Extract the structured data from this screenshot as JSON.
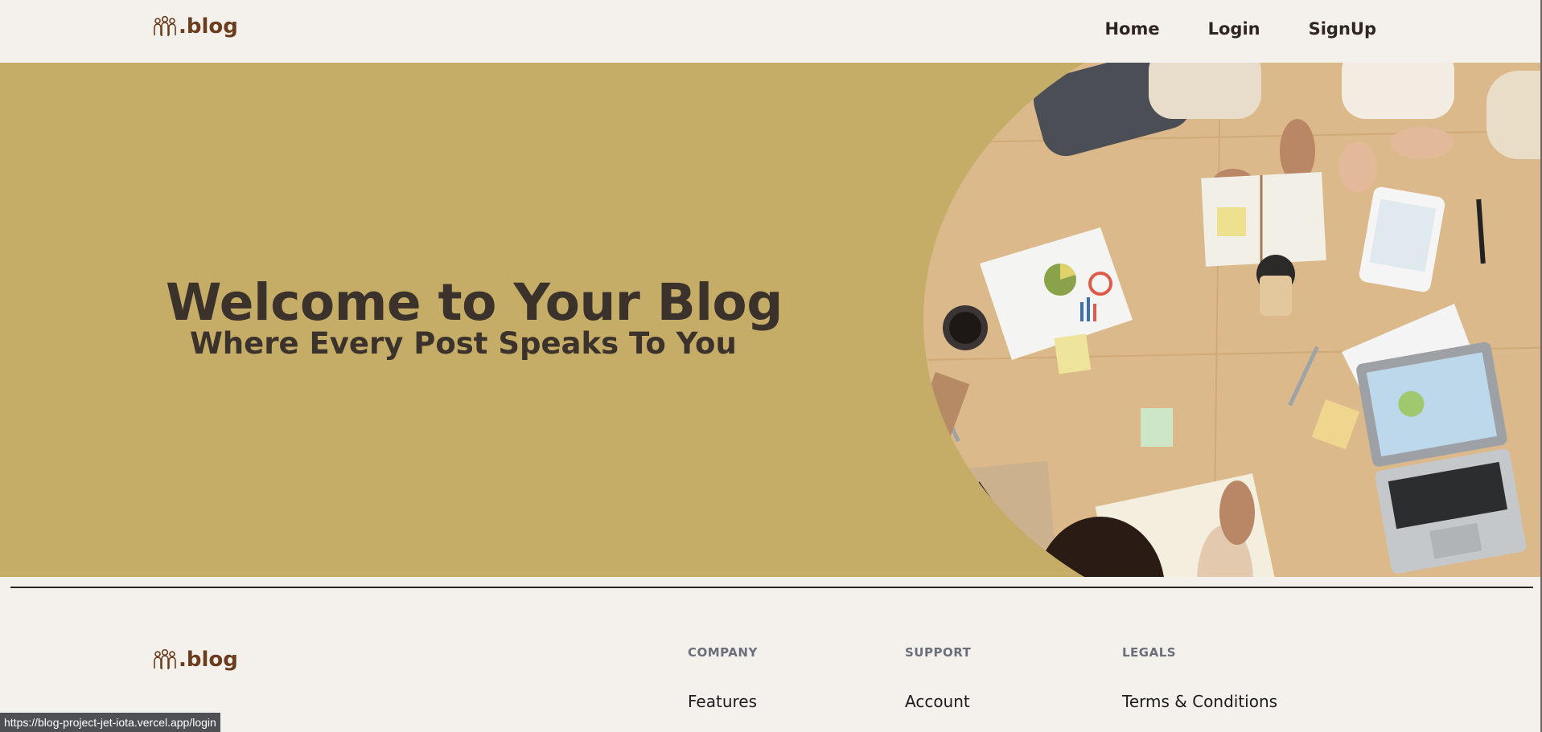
{
  "header": {
    "logo_text": ".blog",
    "nav": [
      {
        "label": "Home"
      },
      {
        "label": "Login"
      },
      {
        "label": "SignUp"
      }
    ]
  },
  "hero": {
    "title": "Welcome to Your Blog",
    "subtitle": "Where Every Post Speaks To You"
  },
  "footer": {
    "logo_text": ".blog",
    "columns": [
      {
        "heading": "COMPANY",
        "links": [
          "Features"
        ]
      },
      {
        "heading": "SUPPORT",
        "links": [
          "Account"
        ]
      },
      {
        "heading": "LEGALS",
        "links": [
          "Terms & Conditions"
        ]
      }
    ]
  },
  "status_bar": {
    "url": "https://blog-project-jet-iota.vercel.app/login"
  },
  "colors": {
    "background": "#f4f1ec",
    "hero_background": "#c5ad67",
    "logo": "#6b3d1e",
    "text_dark": "#3b322c"
  },
  "icons": {
    "logo": "team-people-icon"
  }
}
